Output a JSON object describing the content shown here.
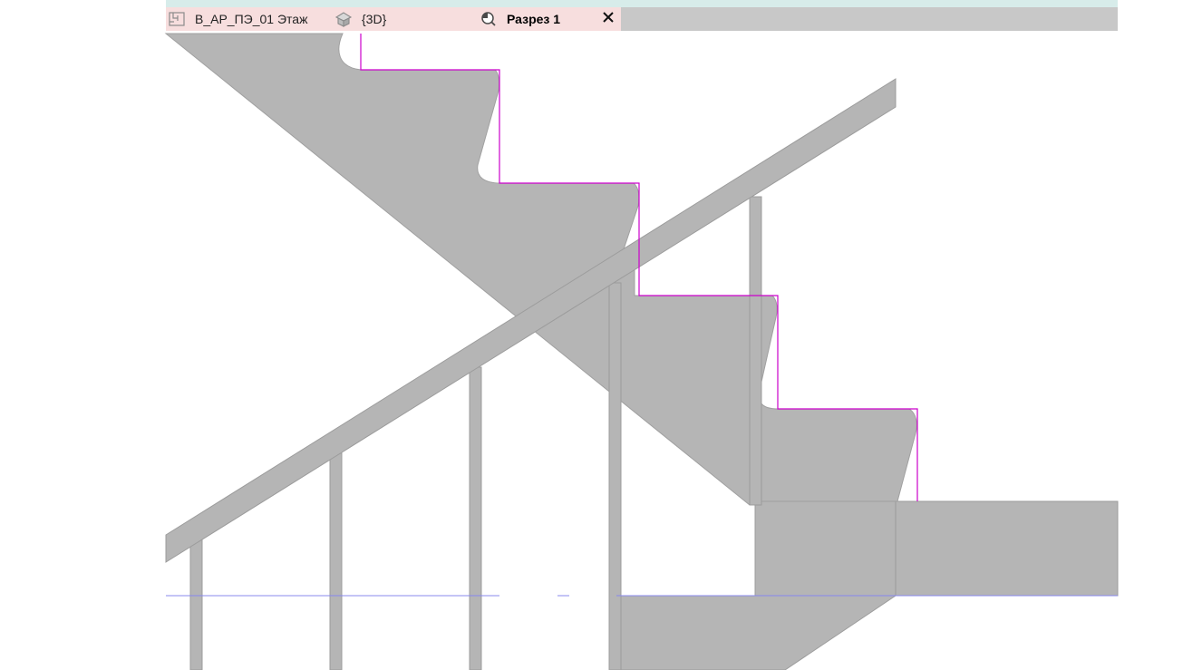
{
  "tabs": [
    {
      "label": "В_АР_ПЭ_01 Этаж",
      "icon": "floor-plan-icon",
      "active": false
    },
    {
      "label": "{3D}",
      "icon": "3d-view-icon",
      "active": false
    },
    {
      "label": "Разрез 1",
      "icon": "section-view-icon",
      "active": true
    }
  ],
  "close_icon": "close-icon",
  "colors": {
    "tab_background": "#f7dede",
    "tab_bar_background": "#c8c8c8",
    "top_strip": "#d7ecea",
    "section_fill": "#b5b5b5",
    "highlight_outline": "#cc00cc",
    "level_line": "#8888ee"
  }
}
